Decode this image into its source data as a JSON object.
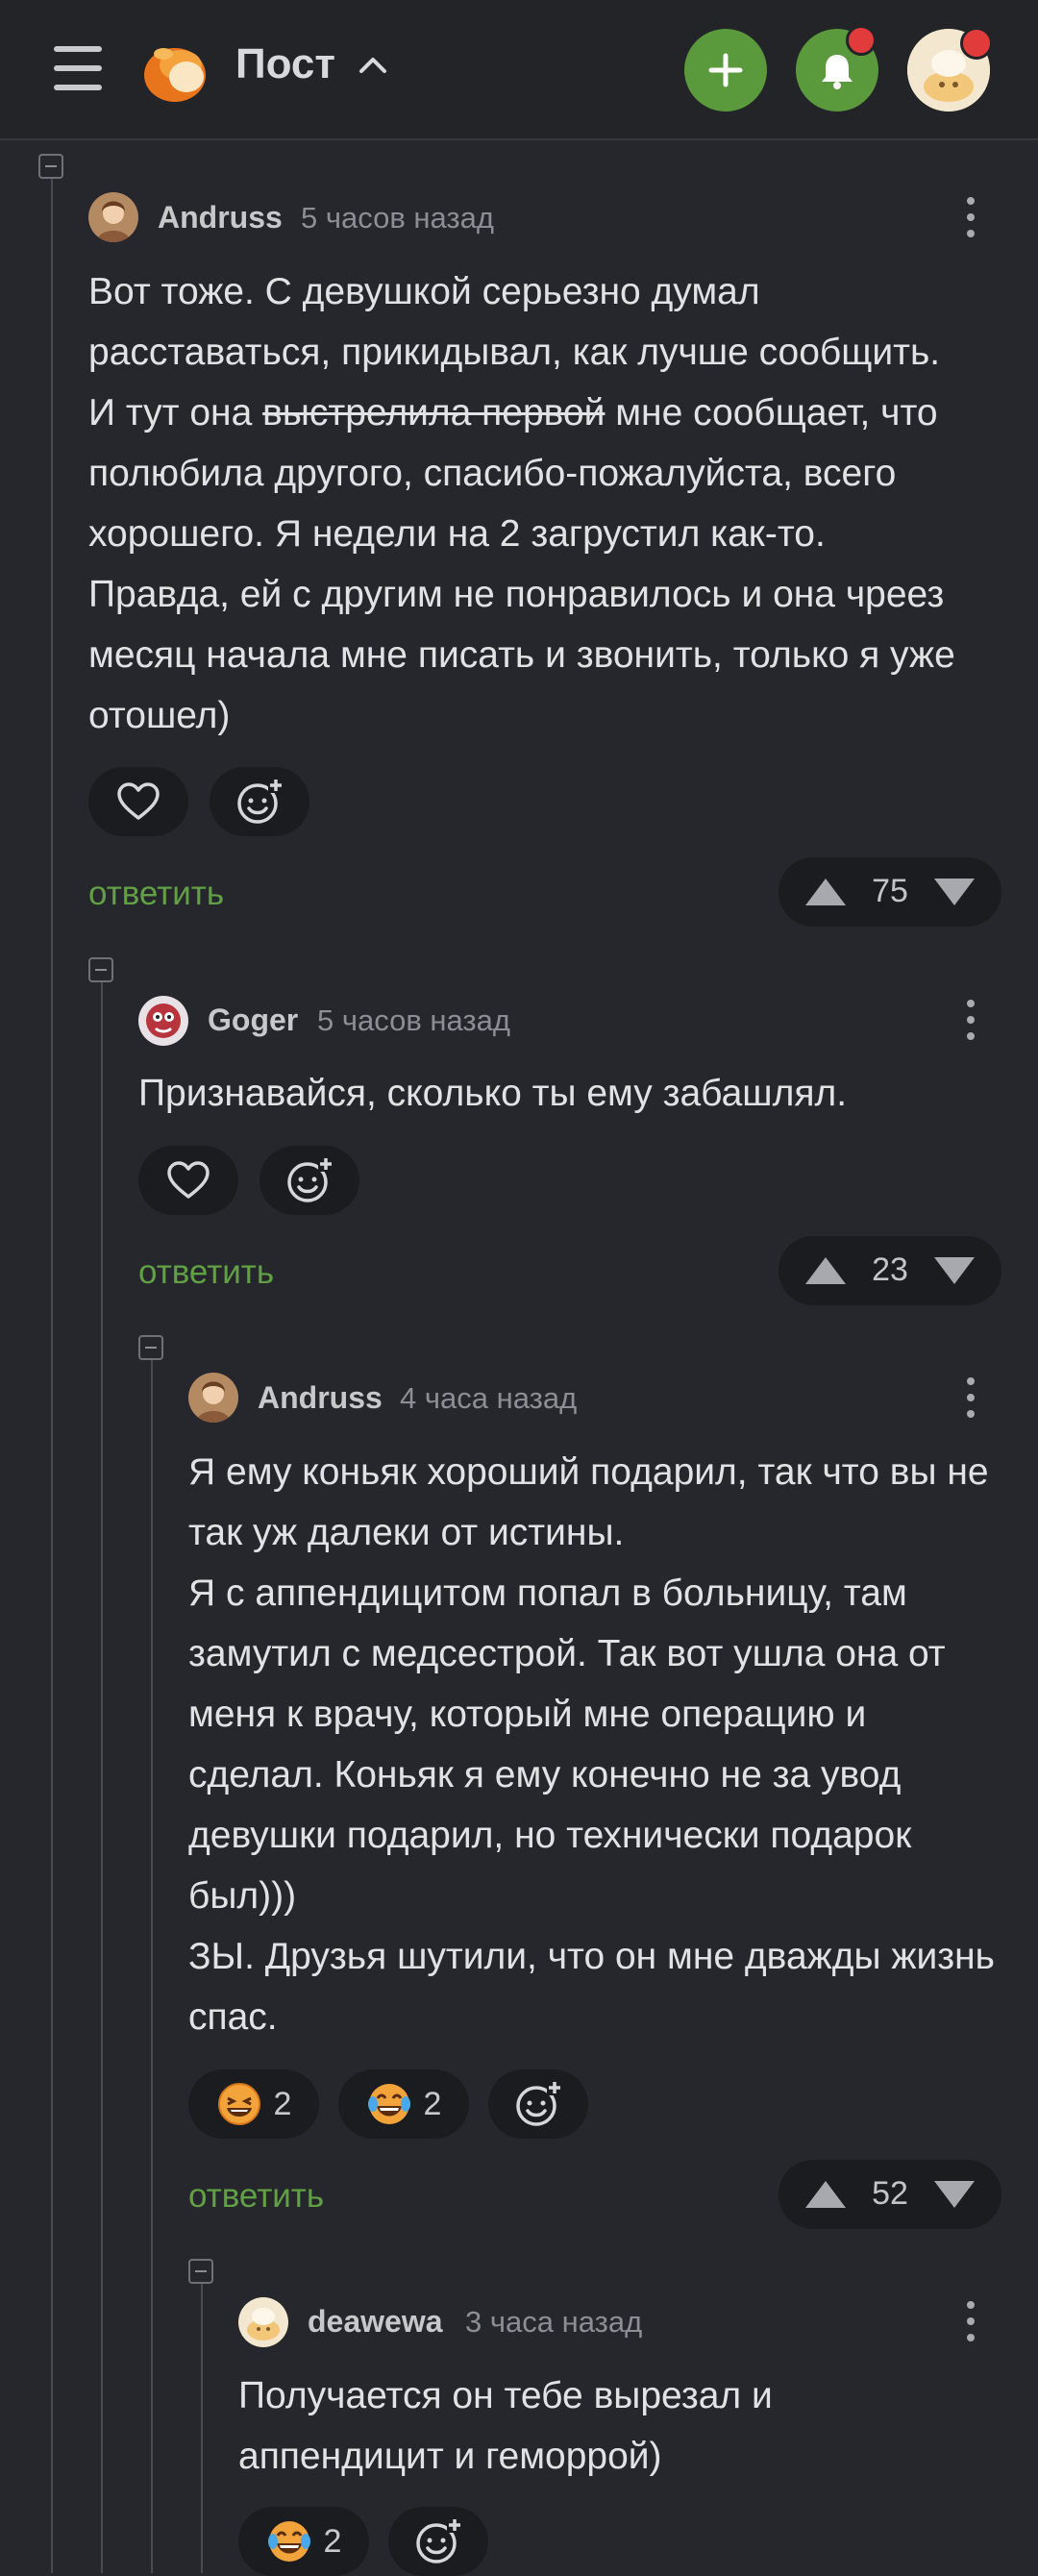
{
  "header": {
    "title": "Пост",
    "menu_icon": "hamburger-icon",
    "add_icon": "plus-icon",
    "bell_icon": "bell-icon",
    "accent_color": "#5a9a3c",
    "badge_color": "#e23b3b"
  },
  "comments": [
    {
      "author": "Andruss",
      "time": "5 часов назад",
      "text_before": "Вот тоже. С девушкой серьезно думал расставаться, прикидывал, как лучше сообщить. И тут она ",
      "text_strike": "выстрелила первой",
      "text_after": " мне сообщает, что полюбила другого, спасибо-пожалуйста, всего хорошего. Я недели на 2 загрустил как-то. Правда, ей с другим не понравилось и она чреез месяц начала мне писать и звонить, только я уже отошел)",
      "reply": "ответить",
      "rating": "75"
    },
    {
      "author": "Goger",
      "time": "5 часов назад",
      "text": "Признавайся, сколько ты ему забашлял.",
      "reply": "ответить",
      "rating": "23"
    },
    {
      "author": "Andruss",
      "time": "4 часа назад",
      "text_lines": [
        "Я ему коньяк хороший подарил, так что вы не так уж далеки от истины.",
        "Я с аппендицитом попал в больницу, там замутил с медсестрой. Так вот ушла она от меня к врачу, который мне операцию и сделал. Коньяк я ему конечно не за увод девушки подарил, но технически подарок был)))",
        "ЗЫ. Друзья шутили, что он мне дважды жизнь спас."
      ],
      "reactions": [
        {
          "icon": "laughing-face-icon",
          "count": "2"
        },
        {
          "icon": "tears-of-joy-icon",
          "count": "2"
        }
      ],
      "reply": "ответить",
      "rating": "52"
    },
    {
      "author": "deawewa",
      "time": "3 часа назад",
      "text": "Получается он тебе вырезал и аппендицит и геморрой)",
      "reactions": [
        {
          "icon": "tears-of-joy-icon",
          "count": "2"
        }
      ]
    }
  ]
}
